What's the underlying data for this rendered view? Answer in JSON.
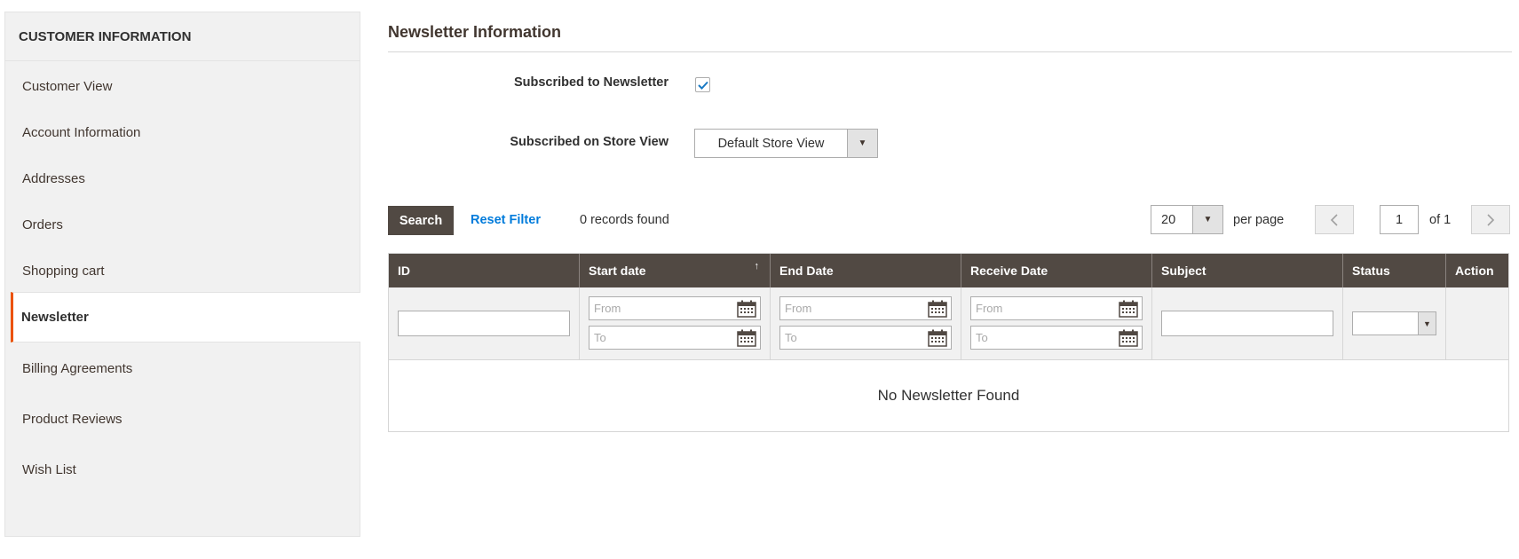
{
  "sidebar": {
    "title": "CUSTOMER INFORMATION",
    "items": [
      {
        "label": "Customer View",
        "active": false
      },
      {
        "label": "Account Information",
        "active": false
      },
      {
        "label": "Addresses",
        "active": false
      },
      {
        "label": "Orders",
        "active": false
      },
      {
        "label": "Shopping cart",
        "active": false
      },
      {
        "label": "Newsletter",
        "active": true
      },
      {
        "label": "Billing Agreements",
        "active": false
      },
      {
        "label": "Product Reviews",
        "active": false
      },
      {
        "label": "Wish List",
        "active": false
      }
    ]
  },
  "main": {
    "section_title": "Newsletter Information",
    "subscribed_label": "Subscribed to Newsletter",
    "subscribed_checked": true,
    "store_view_label": "Subscribed on Store View",
    "store_view_value": "Default Store View"
  },
  "toolbar": {
    "search_label": "Search",
    "reset_label": "Reset Filter",
    "records_text": "0 records found",
    "per_page_value": "20",
    "per_page_label": "per page",
    "current_page": "1",
    "of_pages": "of 1"
  },
  "grid": {
    "columns": [
      {
        "label": "ID"
      },
      {
        "label": "Start date",
        "sorted": "asc"
      },
      {
        "label": "End Date"
      },
      {
        "label": "Receive Date"
      },
      {
        "label": "Subject"
      },
      {
        "label": "Status"
      },
      {
        "label": "Action"
      }
    ],
    "date_from_placeholder": "From",
    "date_to_placeholder": "To",
    "empty_text": "No Newsletter Found"
  },
  "colors": {
    "accent": "#eb5202",
    "header_bg": "#514943",
    "link": "#007bdb",
    "checkbox": "#1979c3"
  }
}
